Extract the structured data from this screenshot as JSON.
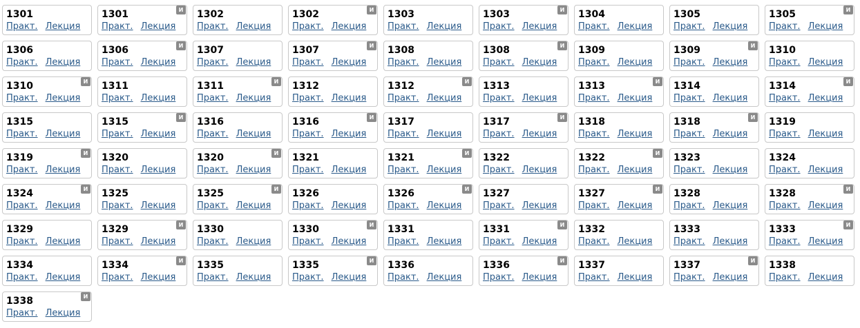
{
  "labels": {
    "practice": "Практ.",
    "lecture": "Лекция",
    "badge": "И"
  },
  "cards": [
    {
      "number": "1301",
      "badge": false
    },
    {
      "number": "1301",
      "badge": true
    },
    {
      "number": "1302",
      "badge": false
    },
    {
      "number": "1302",
      "badge": true
    },
    {
      "number": "1303",
      "badge": false
    },
    {
      "number": "1303",
      "badge": true
    },
    {
      "number": "1304",
      "badge": false
    },
    {
      "number": "1305",
      "badge": false
    },
    {
      "number": "1305",
      "badge": true
    },
    {
      "number": "1306",
      "badge": false
    },
    {
      "number": "1306",
      "badge": true
    },
    {
      "number": "1307",
      "badge": false
    },
    {
      "number": "1307",
      "badge": true
    },
    {
      "number": "1308",
      "badge": false
    },
    {
      "number": "1308",
      "badge": true
    },
    {
      "number": "1309",
      "badge": false
    },
    {
      "number": "1309",
      "badge": true
    },
    {
      "number": "1310",
      "badge": false
    },
    {
      "number": "1310",
      "badge": true
    },
    {
      "number": "1311",
      "badge": false
    },
    {
      "number": "1311",
      "badge": true
    },
    {
      "number": "1312",
      "badge": false
    },
    {
      "number": "1312",
      "badge": true
    },
    {
      "number": "1313",
      "badge": false
    },
    {
      "number": "1313",
      "badge": true
    },
    {
      "number": "1314",
      "badge": false
    },
    {
      "number": "1314",
      "badge": true
    },
    {
      "number": "1315",
      "badge": false
    },
    {
      "number": "1315",
      "badge": true
    },
    {
      "number": "1316",
      "badge": false
    },
    {
      "number": "1316",
      "badge": true
    },
    {
      "number": "1317",
      "badge": false
    },
    {
      "number": "1317",
      "badge": true
    },
    {
      "number": "1318",
      "badge": false
    },
    {
      "number": "1318",
      "badge": true
    },
    {
      "number": "1319",
      "badge": false
    },
    {
      "number": "1319",
      "badge": true
    },
    {
      "number": "1320",
      "badge": false
    },
    {
      "number": "1320",
      "badge": true
    },
    {
      "number": "1321",
      "badge": false
    },
    {
      "number": "1321",
      "badge": true
    },
    {
      "number": "1322",
      "badge": false
    },
    {
      "number": "1322",
      "badge": true
    },
    {
      "number": "1323",
      "badge": false
    },
    {
      "number": "1324",
      "badge": false
    },
    {
      "number": "1324",
      "badge": true
    },
    {
      "number": "1325",
      "badge": false
    },
    {
      "number": "1325",
      "badge": true
    },
    {
      "number": "1326",
      "badge": false
    },
    {
      "number": "1326",
      "badge": true
    },
    {
      "number": "1327",
      "badge": false
    },
    {
      "number": "1327",
      "badge": true
    },
    {
      "number": "1328",
      "badge": false
    },
    {
      "number": "1328",
      "badge": true
    },
    {
      "number": "1329",
      "badge": false
    },
    {
      "number": "1329",
      "badge": true
    },
    {
      "number": "1330",
      "badge": false
    },
    {
      "number": "1330",
      "badge": true
    },
    {
      "number": "1331",
      "badge": false
    },
    {
      "number": "1331",
      "badge": true
    },
    {
      "number": "1332",
      "badge": false
    },
    {
      "number": "1333",
      "badge": false
    },
    {
      "number": "1333",
      "badge": true
    },
    {
      "number": "1334",
      "badge": false
    },
    {
      "number": "1334",
      "badge": true
    },
    {
      "number": "1335",
      "badge": false
    },
    {
      "number": "1335",
      "badge": true
    },
    {
      "number": "1336",
      "badge": false
    },
    {
      "number": "1336",
      "badge": true
    },
    {
      "number": "1337",
      "badge": false
    },
    {
      "number": "1337",
      "badge": true
    },
    {
      "number": "1338",
      "badge": false
    },
    {
      "number": "1338",
      "badge": true
    }
  ],
  "colors": {
    "link": "#2a5a8a",
    "border": "#c8c8c8",
    "badge": "#8a8a8a"
  }
}
